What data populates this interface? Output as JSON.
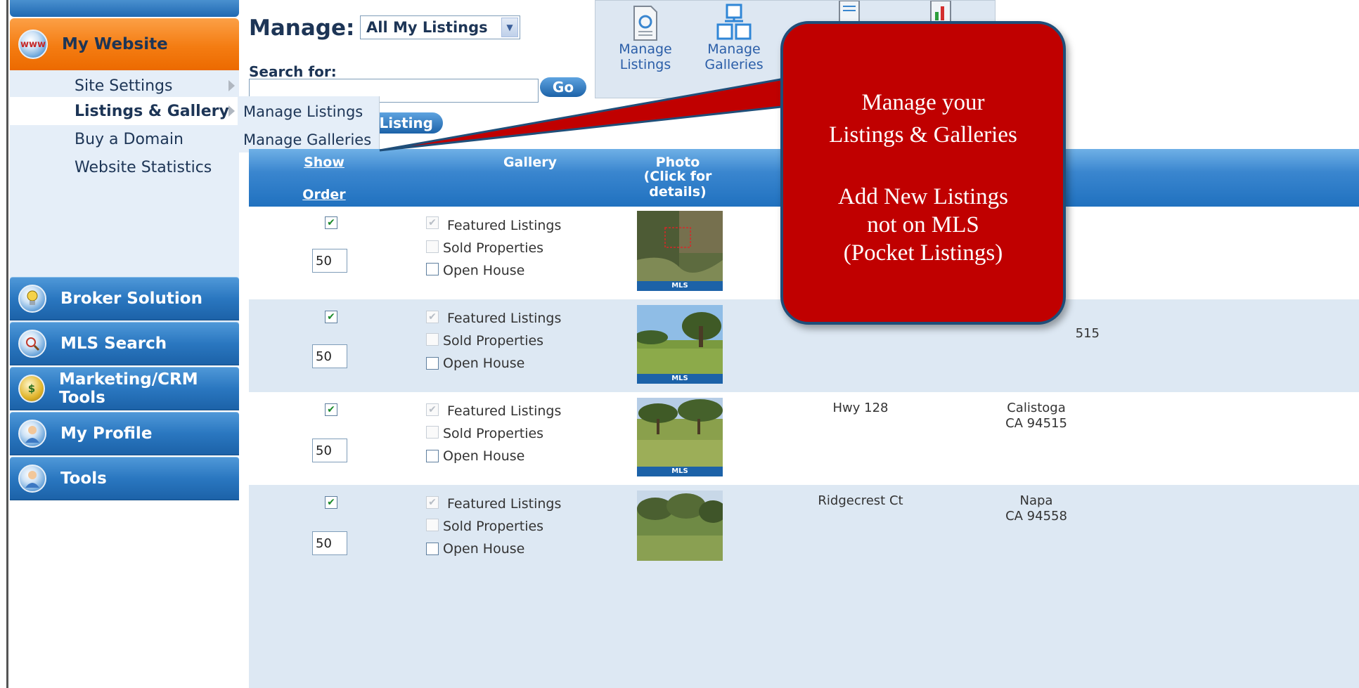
{
  "sidebar": {
    "header": {
      "label": "My Website",
      "icon": "www-globe-icon"
    },
    "submenu": [
      {
        "label": "Site Settings",
        "has_arrow": true
      },
      {
        "label": "Listings & Gallery",
        "has_arrow": true,
        "active": true
      },
      {
        "label": "Buy a Domain"
      },
      {
        "label": "Website Statistics"
      }
    ],
    "sections": [
      {
        "label": "Broker Solution",
        "icon": "lightbulb-icon"
      },
      {
        "label": "MLS Search",
        "icon": "magnifier-icon"
      },
      {
        "label": "Marketing/CRM Tools",
        "icon": "money-bag-icon"
      },
      {
        "label": "My Profile",
        "icon": "person-icon"
      },
      {
        "label": "Tools",
        "icon": "person-icon"
      }
    ]
  },
  "popup_menu": [
    "Manage Listings",
    "Manage Galleries"
  ],
  "manage": {
    "label": "Manage:",
    "selected": "All My Listings"
  },
  "search": {
    "label": "Search for:",
    "value": "",
    "go": "Go"
  },
  "add_listing_button": "d Listing",
  "toolbar": [
    {
      "label_line1": "Manage",
      "label_line2": "Listings",
      "icon": "document-icon"
    },
    {
      "label_line1": "Manage",
      "label_line2": "Galleries",
      "icon": "gallery-boxes-icon"
    },
    {
      "label_line1": "",
      "label_line2": "",
      "icon": "list-document-icon"
    },
    {
      "label_line1": "",
      "label_line2": "",
      "icon": "bar-chart-icon"
    }
  ],
  "table": {
    "headers": {
      "show_line1": "Show",
      "show_line2": "Order",
      "gallery": "Gallery",
      "photo_line1": "Photo",
      "photo_line2": "(Click for",
      "photo_line3": "details)"
    },
    "gallery_options": [
      "Featured Listings",
      "Sold Properties",
      "Open House"
    ],
    "rows": [
      {
        "show": true,
        "order": "50",
        "badge": "MLS",
        "address": "",
        "city": "",
        "zip": ""
      },
      {
        "show": true,
        "order": "50",
        "badge": "MLS",
        "address": "",
        "city": "",
        "zip": "515"
      },
      {
        "show": true,
        "order": "50",
        "badge": "MLS",
        "address": "Hwy 128",
        "city": "Calistoga",
        "zip": "CA 94515"
      },
      {
        "show": true,
        "order": "50",
        "badge": "",
        "address": "Ridgecrest Ct",
        "city": "Napa",
        "zip": "CA 94558"
      }
    ]
  },
  "callout": {
    "line1": "Manage your",
    "line2": "Listings & Galleries",
    "line3": "Add New Listings",
    "line4": "not on MLS",
    "line5": "(Pocket Listings)",
    "color": "#c00000"
  }
}
